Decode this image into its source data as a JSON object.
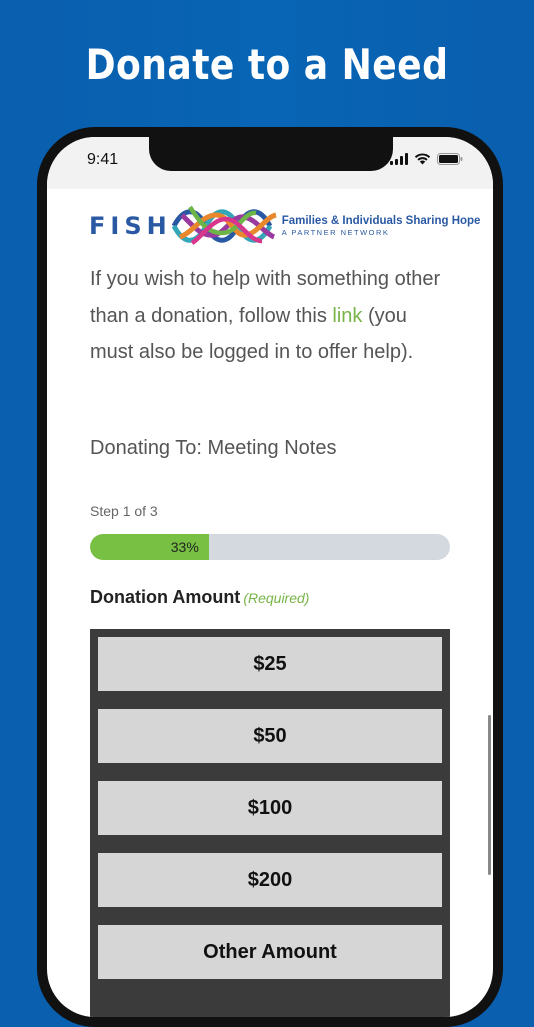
{
  "headline": "Donate to a Need",
  "status": {
    "time": "9:41"
  },
  "logo": {
    "wordmark": "FISH",
    "tagline": "Families & Individuals Sharing Hope",
    "subline": "A PARTNER NETWORK"
  },
  "intro": {
    "before_link": "If you wish to help with something other than a donation, follow this ",
    "link_text": "link",
    "after_link": " (you must also be logged in to offer help)."
  },
  "donating_to": "Donating To: Meeting Notes",
  "progress": {
    "step_text": "Step 1 of 3",
    "percent_label": "33%",
    "fraction": 0.33
  },
  "donation_amount": {
    "label": "Donation Amount",
    "required": "(Required)",
    "options": [
      "$25",
      "$50",
      "$100",
      "$200",
      "Other Amount"
    ]
  },
  "colors": {
    "background": "#0864b4",
    "accent_green": "#78c044",
    "link_green": "#78b447",
    "logo_blue": "#2a59a3"
  }
}
